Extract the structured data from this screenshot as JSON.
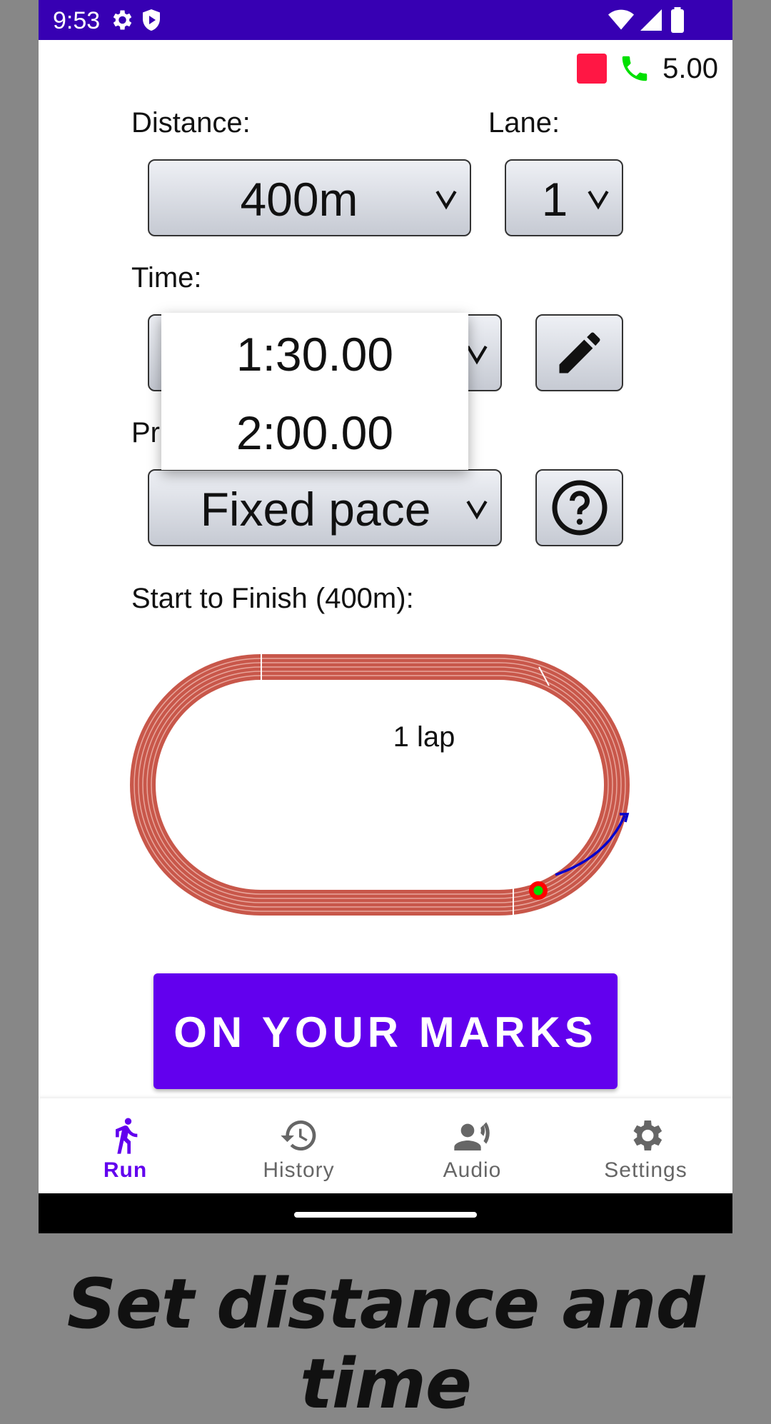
{
  "status_bar": {
    "time": "9:53"
  },
  "header": {
    "speed": "5.00"
  },
  "form": {
    "distance_label": "Distance:",
    "distance_value": "400m",
    "lane_label": "Lane:",
    "lane_value": "1",
    "time_label": "Time:",
    "time_options": [
      "1:30.00",
      "2:00.00"
    ],
    "profile_label_partial": "Pr",
    "profile_value": "Fixed pace"
  },
  "track": {
    "label": "Start to Finish (400m):",
    "laps_text": "1 lap",
    "colors": {
      "track": "#c8574a",
      "start_marker": "#ff0000",
      "runner_dot": "#00e000",
      "arrow": "#0000cc"
    }
  },
  "cta": {
    "label": "ON YOUR MARKS"
  },
  "bottom_nav": {
    "items": [
      {
        "label": "Run",
        "icon": "run-icon",
        "active": true
      },
      {
        "label": "History",
        "icon": "history-icon",
        "active": false
      },
      {
        "label": "Audio",
        "icon": "audio-icon",
        "active": false
      },
      {
        "label": "Settings",
        "icon": "settings-icon",
        "active": false
      }
    ]
  },
  "caption": "Set distance and time",
  "colors": {
    "status_bar": "#3700b3",
    "accent": "#6200ee",
    "background": "#878787"
  }
}
